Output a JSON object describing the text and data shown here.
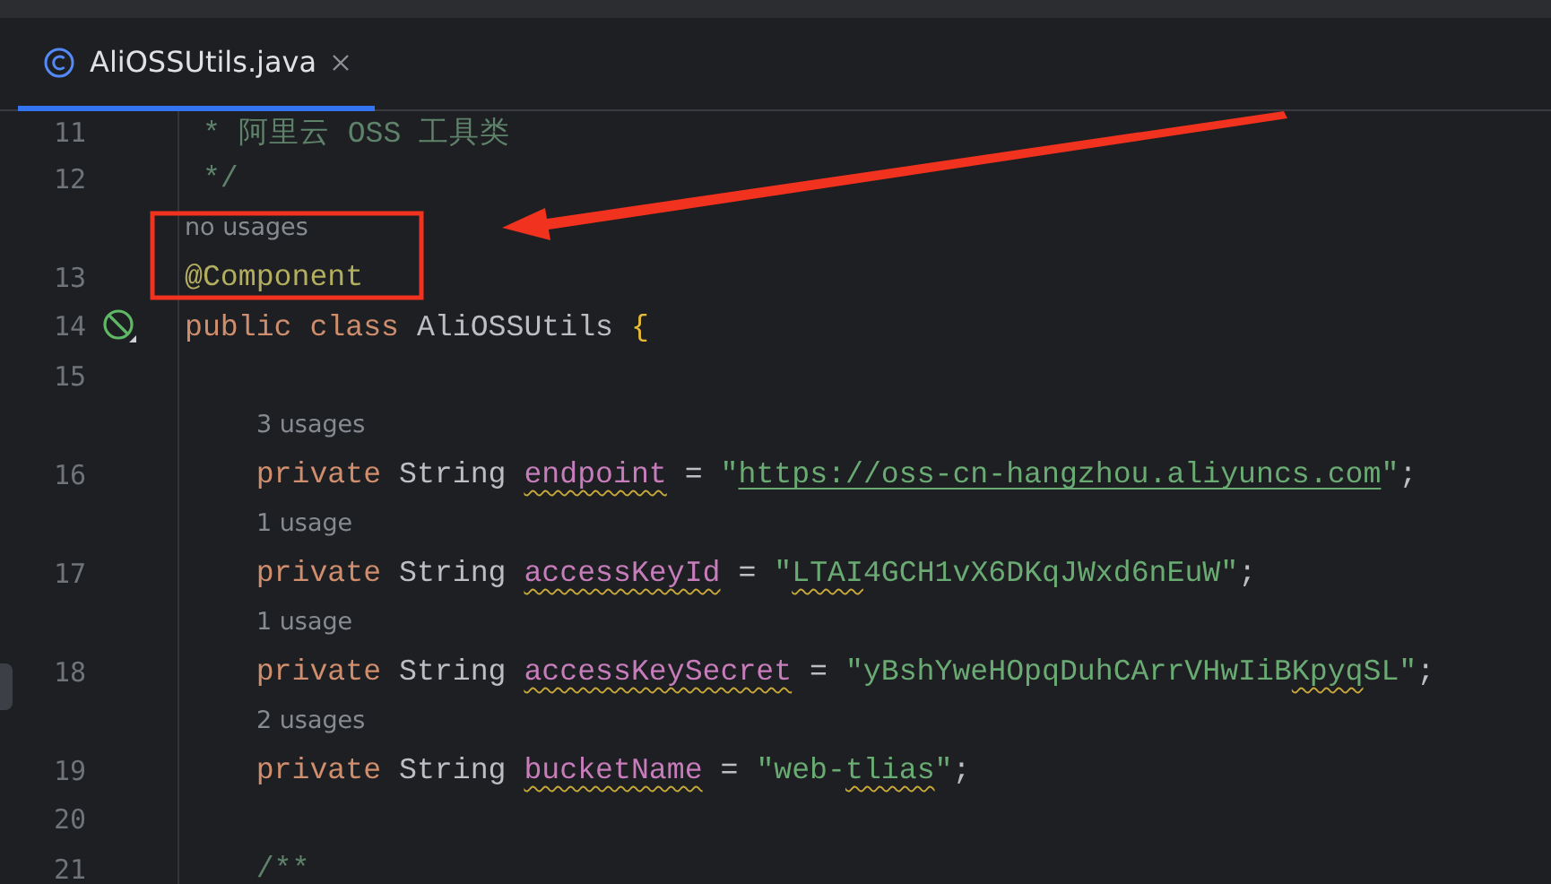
{
  "tabs": [
    {
      "label": "AliOSSUtils.java",
      "selected": true
    }
  ],
  "lines": [
    {
      "number": "11",
      "tokens": [
        {
          "kind": "comment",
          "text": " * 阿里云 OSS 工具类"
        }
      ]
    },
    {
      "number": "12",
      "tokens": [
        {
          "kind": "comment",
          "text": " */"
        }
      ]
    },
    {
      "number": "13",
      "hint": "no usages",
      "tokens": [
        {
          "kind": "annotation",
          "text": "@Component"
        }
      ]
    },
    {
      "number": "14",
      "bean_marker": true,
      "tokens": [
        {
          "kind": "keyword",
          "text": "public class "
        },
        {
          "kind": "plain",
          "text": "AliOSSUtils "
        },
        {
          "kind": "brace",
          "text": "{"
        }
      ]
    },
    {
      "number": "15"
    },
    {
      "number": "16",
      "hint": "3 usages",
      "tokens": [
        {
          "kind": "keyword",
          "text": "    private "
        },
        {
          "kind": "plain",
          "text": "String "
        },
        {
          "kind": "field",
          "text": "endpoint",
          "warning": true
        },
        {
          "kind": "plain",
          "text": " = "
        },
        {
          "kind": "string",
          "text": "\""
        },
        {
          "kind": "url",
          "text": "https://oss-cn-hangzhou.aliyuncs.com"
        },
        {
          "kind": "string",
          "text": "\""
        },
        {
          "kind": "plain",
          "text": ";"
        }
      ]
    },
    {
      "number": "17",
      "hint": "1 usage",
      "tokens": [
        {
          "kind": "keyword",
          "text": "    private "
        },
        {
          "kind": "plain",
          "text": "String "
        },
        {
          "kind": "field",
          "text": "accessKeyId",
          "warning": true
        },
        {
          "kind": "plain",
          "text": " = "
        },
        {
          "kind": "string",
          "text": "\""
        },
        {
          "kind": "string",
          "text": "LTAI",
          "warning": true
        },
        {
          "kind": "string",
          "text": "4GCH1vX6DKqJWxd6nEuW\""
        },
        {
          "kind": "plain",
          "text": ";"
        }
      ]
    },
    {
      "number": "18",
      "hint": "1 usage",
      "tokens": [
        {
          "kind": "keyword",
          "text": "    private "
        },
        {
          "kind": "plain",
          "text": "String "
        },
        {
          "kind": "field",
          "text": "accessKeySecret",
          "warning": true
        },
        {
          "kind": "plain",
          "text": " = "
        },
        {
          "kind": "string",
          "text": "\"yBshYweHOpqDuhCArrVHwIiB"
        },
        {
          "kind": "string",
          "text": "Kpyq",
          "warning": true
        },
        {
          "kind": "string",
          "text": "SL\""
        },
        {
          "kind": "plain",
          "text": ";"
        }
      ]
    },
    {
      "number": "19",
      "hint": "2 usages",
      "tokens": [
        {
          "kind": "keyword",
          "text": "    private "
        },
        {
          "kind": "plain",
          "text": "String "
        },
        {
          "kind": "field",
          "text": "bucketName",
          "warning": true
        },
        {
          "kind": "plain",
          "text": " = "
        },
        {
          "kind": "string",
          "text": "\"web-"
        },
        {
          "kind": "string",
          "text": "tlias",
          "warning": true
        },
        {
          "kind": "string",
          "text": "\""
        },
        {
          "kind": "plain",
          "text": ";"
        }
      ]
    },
    {
      "number": "20"
    },
    {
      "number": "21",
      "tokens": [
        {
          "kind": "comment",
          "text": "    /**"
        }
      ]
    }
  ]
}
